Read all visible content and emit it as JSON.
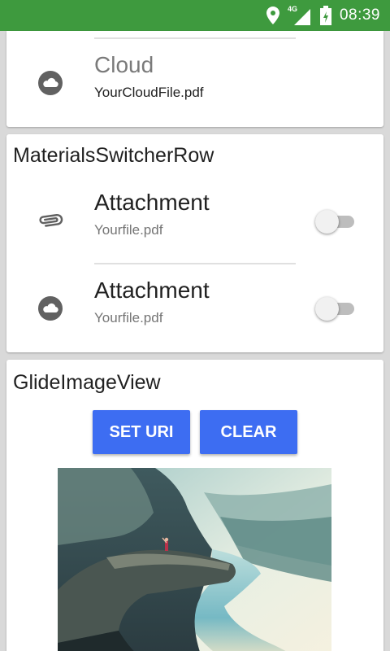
{
  "status_bar": {
    "network_label": "4G",
    "time": "08:39",
    "background": "#3e9a3e",
    "icons": [
      "location-icon",
      "signal-icon",
      "battery-icon"
    ]
  },
  "cloud_card": {
    "title": "Cloud",
    "file": "YourCloudFile.pdf",
    "icon": "cloud-icon"
  },
  "switcher_card": {
    "heading": "MaterialsSwitcherRow",
    "rows": [
      {
        "title": "Attachment",
        "file": "Yourfile.pdf",
        "icon": "paperclip-icon",
        "checked": false
      },
      {
        "title": "Attachment",
        "file": "Yourfile.pdf",
        "icon": "cloud-icon",
        "checked": false
      }
    ]
  },
  "glide_card": {
    "heading": "GlideImageView",
    "set_uri_label": "SET URI",
    "clear_label": "CLEAR",
    "accent": "#3d6df2",
    "image": "photo of a hiker standing on a cliff ledge above a fjord lake"
  }
}
